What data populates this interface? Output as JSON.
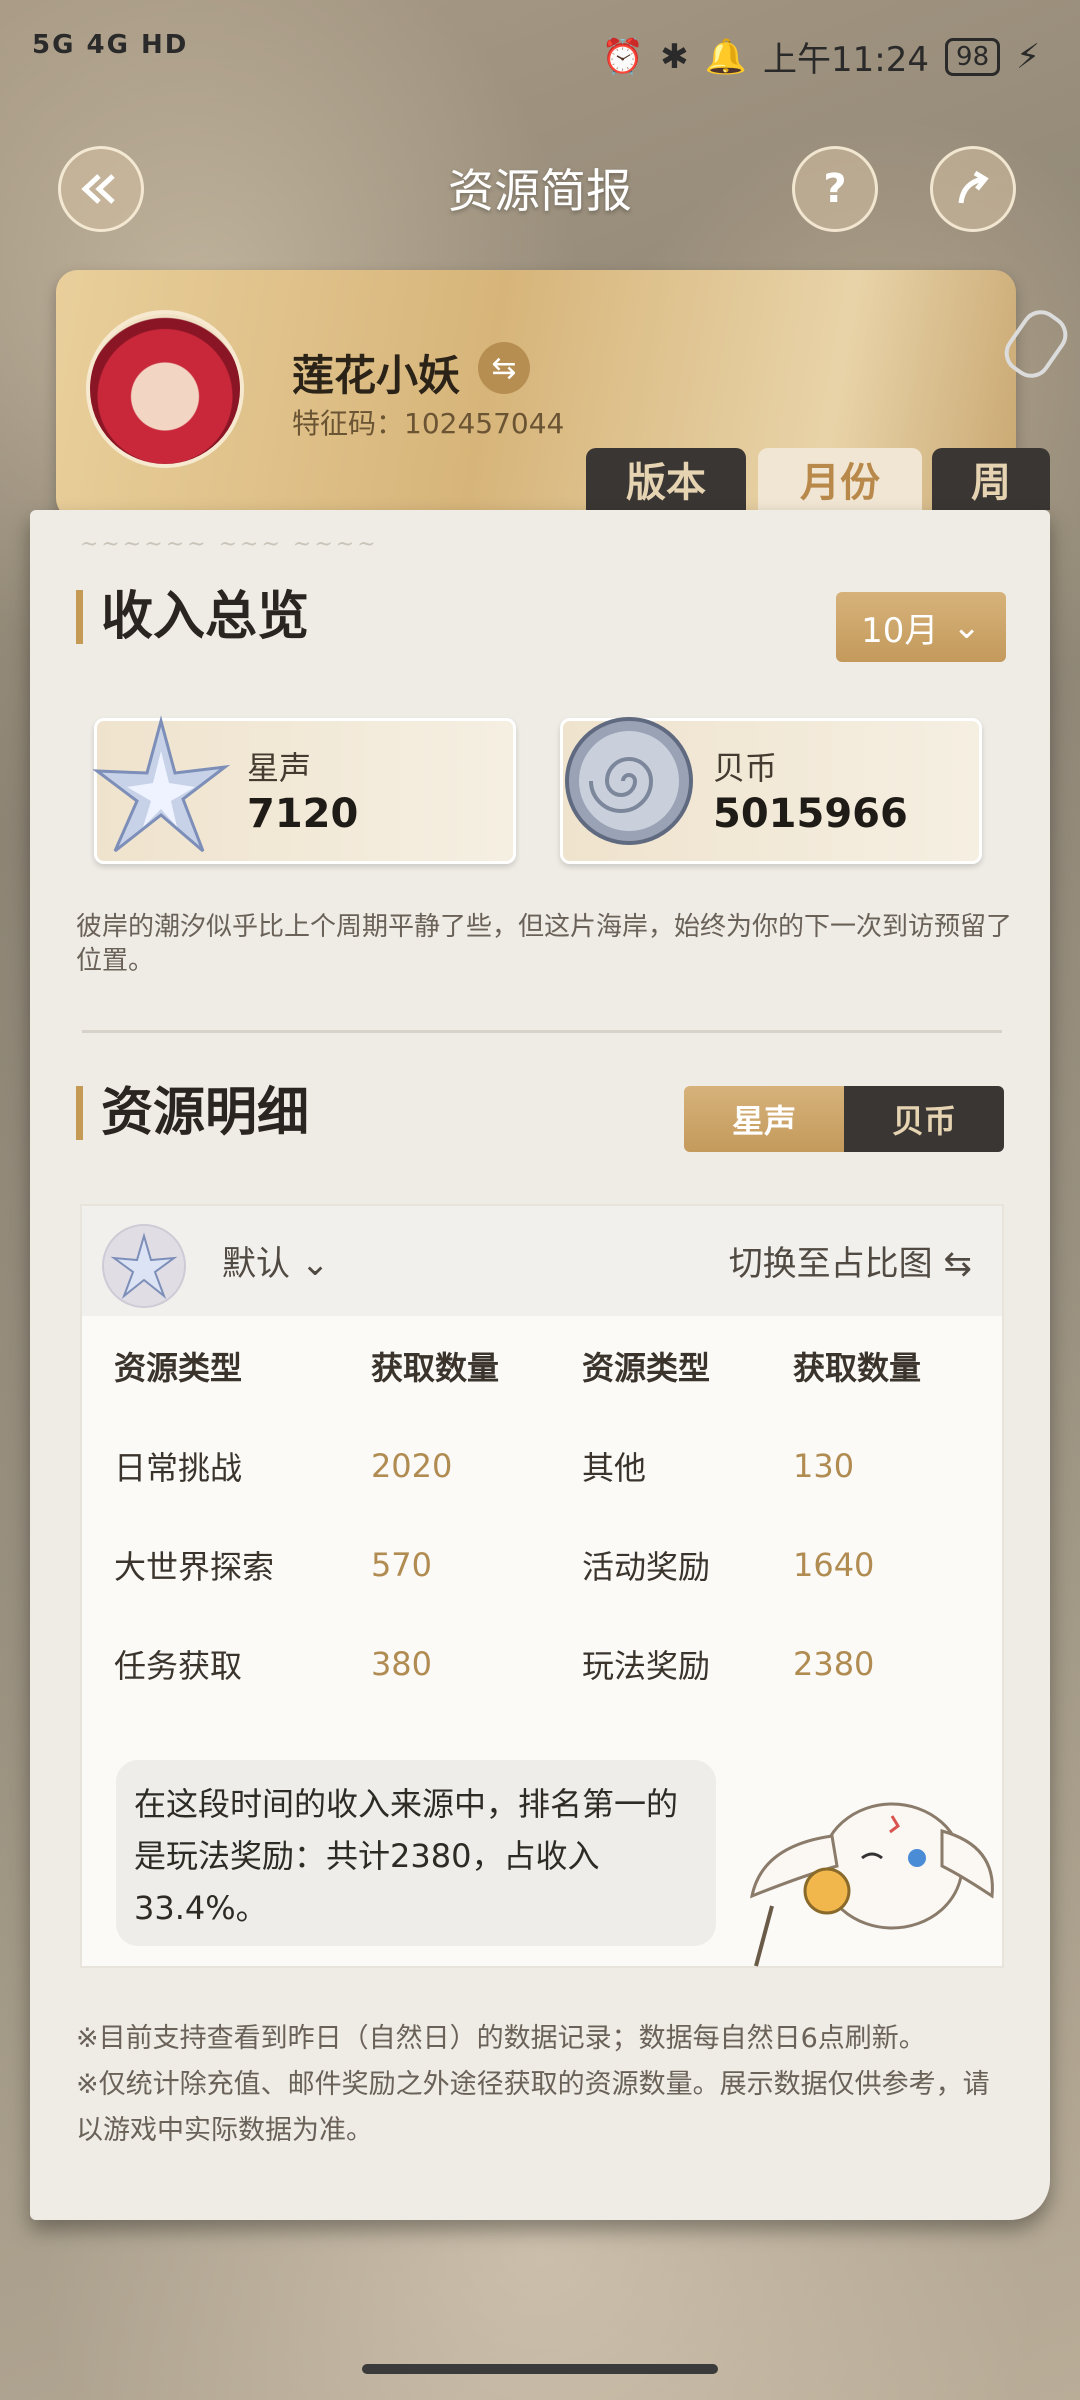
{
  "status_bar": {
    "signal": "5G 4G HD",
    "time": "上午11:24",
    "battery": "98"
  },
  "header": {
    "title": "资源简报",
    "back_icon": "back-arrow-icon",
    "help_label": "?",
    "share_icon": "share-icon"
  },
  "profile": {
    "name": "莲花小妖",
    "id_label": "特征码：102457044"
  },
  "tabs": [
    {
      "label": "版本"
    },
    {
      "label": "月份"
    },
    {
      "label": "周"
    }
  ],
  "overview": {
    "title": "收入总览",
    "month": "10月",
    "resources": [
      {
        "label": "星声",
        "value": "7120"
      },
      {
        "label": "贝币",
        "value": "5015966"
      }
    ],
    "description": "彼岸的潮汐似乎比上个周期平静了些，但这片海岸，始终为你的下一次到访预留了位置。"
  },
  "detail": {
    "title": "资源明细",
    "segments": [
      "星声",
      "贝币"
    ],
    "filter_label": "默认",
    "switch_label": "切换至占比图",
    "headers": [
      "资源类型",
      "获取数量",
      "资源类型",
      "获取数量"
    ],
    "rows": [
      [
        "日常挑战",
        "2020",
        "其他",
        "130"
      ],
      [
        "大世界探索",
        "570",
        "活动奖励",
        "1640"
      ],
      [
        "任务获取",
        "380",
        "玩法奖励",
        "2380"
      ]
    ],
    "summary": "在这段时间的收入来源中，排名第一的是玩法奖励：共计2380，占收入33.4%。"
  },
  "notes": [
    "※目前支持查看到昨日（自然日）的数据记录；数据每自然日6点刷新。",
    "※仅统计除充值、邮件奖励之外途径获取的资源数量。展示数据仅供参考，请以游戏中实际数据为准。"
  ],
  "colors": {
    "accent_gold": "#c49a5c",
    "dark_tab": "#3a3633",
    "value_gold": "#b18c52"
  }
}
